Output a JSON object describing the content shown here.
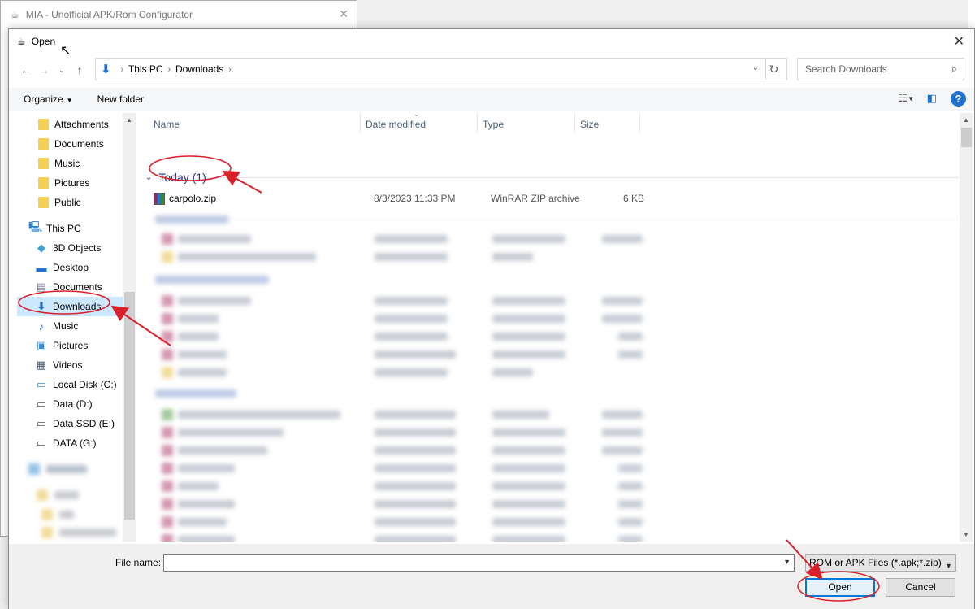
{
  "background_window": {
    "title": "MIA - Unofficial APK/Rom Configurator",
    "icon": "app-icon",
    "close_label": "✕"
  },
  "dialog": {
    "title": "Open",
    "icon": "app-icon",
    "close_label": "✕"
  },
  "address": {
    "crumbs": [
      "This PC",
      "Downloads"
    ],
    "search_placeholder": "Search Downloads"
  },
  "toolbar": {
    "organize_label": "Organize",
    "new_folder_label": "New folder",
    "help_label": "?"
  },
  "nav_pane": {
    "quick_items": [
      "Attachments",
      "Documents",
      "Music",
      "Pictures",
      "Public"
    ],
    "this_pc_label": "This PC",
    "pc_items": [
      "3D Objects",
      "Desktop",
      "Documents",
      "Downloads",
      "Music",
      "Pictures",
      "Videos",
      "Local Disk (C:)",
      "Data (D:)",
      "Data SSD (E:)",
      "DATA (G:)"
    ],
    "selected": "Downloads"
  },
  "columns": {
    "name": "Name",
    "date_modified": "Date modified",
    "type": "Type",
    "size": "Size"
  },
  "groups": [
    {
      "label": "Today (1)",
      "files": [
        {
          "name": "carpolo.zip",
          "date": "8/3/2023 11:33 PM",
          "type": "WinRAR ZIP archive",
          "size": "6 KB"
        }
      ]
    }
  ],
  "bottom": {
    "file_name_label": "File name:",
    "file_name_value": "",
    "filter_label": "ROM or APK Files (*.apk;*.zip)",
    "open_label": "Open",
    "cancel_label": "Cancel"
  },
  "colors": {
    "selection": "#cce8ff",
    "accent": "#0078d7",
    "group_header": "#1e3287",
    "annotation": "#d9202a"
  }
}
